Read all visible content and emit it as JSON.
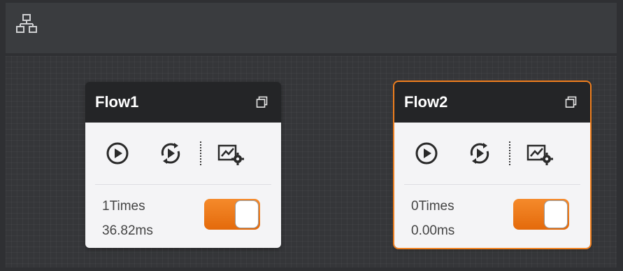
{
  "toolbar": {
    "topology_icon": "network-topology-icon"
  },
  "flows": [
    {
      "title": "Flow1",
      "count": "1Times",
      "time": "36.82ms",
      "enabled": true,
      "selected": false
    },
    {
      "title": "Flow2",
      "count": "0Times",
      "time": "0.00ms",
      "enabled": true,
      "selected": true
    }
  ],
  "icons": {
    "restore": "restore-window-icon",
    "run": "play-circle-icon",
    "loop": "loop-run-icon",
    "settings": "chart-settings-icon"
  },
  "colors": {
    "accent": "#f07f1e",
    "header": "#242527",
    "card": "#f4f4f6",
    "canvas": "#353639"
  }
}
